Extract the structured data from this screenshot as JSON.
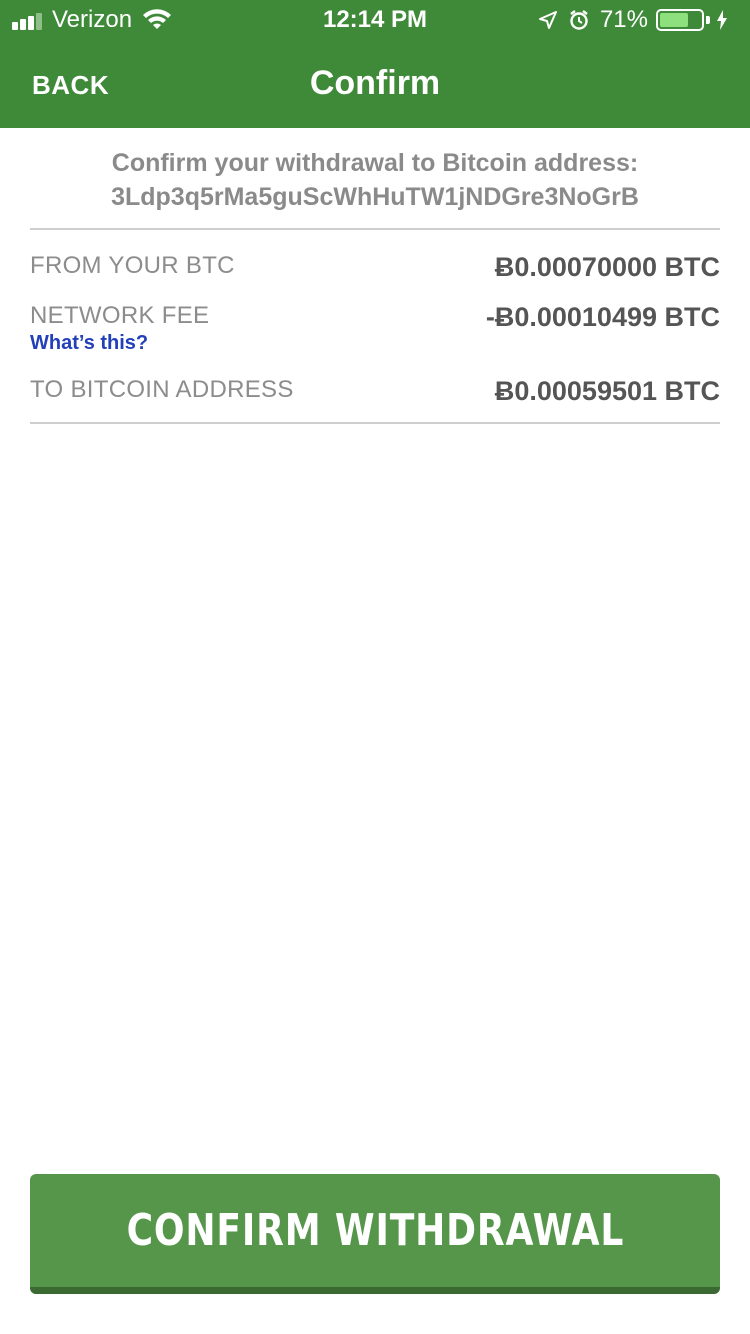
{
  "status_bar": {
    "carrier": "Verizon",
    "time": "12:14 PM",
    "battery_percent": "71%",
    "battery_level": 0.71,
    "icons": [
      "signal-icon",
      "wifi-icon",
      "location-icon",
      "alarm-icon",
      "battery-icon",
      "charging-icon"
    ]
  },
  "nav": {
    "back_label": "BACK",
    "title": "Confirm"
  },
  "confirm": {
    "line1": "Confirm your withdrawal to Bitcoin address:",
    "address": "3Ldp3q5rMa5guScWhHuTW1jNDGre3NoGrB"
  },
  "rows": [
    {
      "label": "FROM YOUR BTC",
      "value": "Ƀ0.00070000 BTC"
    },
    {
      "label": "NETWORK FEE",
      "value": "-Ƀ0.00010499 BTC",
      "link": "What’s this?"
    },
    {
      "label": "TO BITCOIN ADDRESS",
      "value": "Ƀ0.00059501 BTC"
    }
  ],
  "button": {
    "label": "CONFIRM WITHDRAWAL"
  },
  "colors": {
    "header": "#3f8a38",
    "button": "#55964a",
    "link": "#2340b8"
  }
}
